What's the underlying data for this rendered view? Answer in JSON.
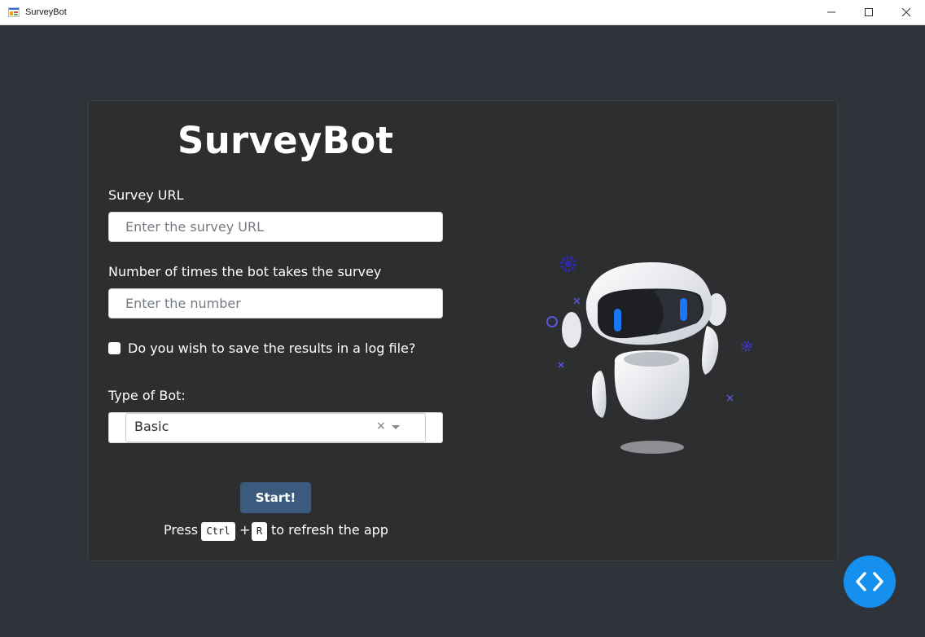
{
  "window": {
    "title": "SurveyBot"
  },
  "form": {
    "heading": "SurveyBot",
    "survey_url_label": "Survey URL",
    "survey_url_placeholder": "Enter the survey URL",
    "runs_label": "Number of times the bot takes the survey",
    "runs_placeholder": "Enter the number",
    "log_checkbox_label": "Do you wish to save the results in a log file?",
    "log_checkbox_checked": false,
    "bot_type_label": "Type of Bot:",
    "bot_type_selected": "Basic",
    "clear_symbol": "×",
    "start_button": "Start!",
    "hint": {
      "press": "Press",
      "key1": "Ctrl",
      "plus": "+",
      "key2": "R",
      "suffix": "to refresh the app"
    }
  },
  "illustration": {
    "icon": "robot-illustration-icon"
  },
  "fab": {
    "icon": "code-brackets-icon",
    "color": "#1590ef"
  },
  "colors": {
    "background": "#2f333a",
    "card": "#2d2e30",
    "start_button": "#3b5a7d"
  }
}
